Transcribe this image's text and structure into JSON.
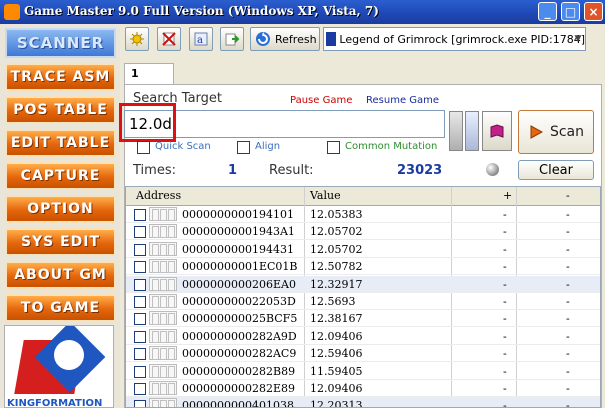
{
  "window": {
    "title": "Game Master 9.0 Full Version (Windows XP, Vista, 7)",
    "minimize": "_",
    "maximize": "□",
    "close": "×"
  },
  "sidebar": {
    "scanner": "SCANNER",
    "items": [
      {
        "label": "TRACE ASM"
      },
      {
        "label": "POS TABLE"
      },
      {
        "label": "EDIT TABLE"
      },
      {
        "label": "CAPTURE"
      },
      {
        "label": "OPTION"
      },
      {
        "label": "SYS EDIT"
      },
      {
        "label": "ABOUT GM"
      },
      {
        "label": "TO GAME"
      }
    ],
    "logo_text": "KINGFORMATION"
  },
  "toolbar": {
    "refresh_label": "Refresh",
    "process": "Legend of Grimrock [grimrock.exe PID:1784]"
  },
  "tabs": [
    {
      "label": "1"
    }
  ],
  "search": {
    "label": "Search Target",
    "pause": "Pause Game",
    "resume": "Resume Game",
    "value": "12.0d",
    "scan_label": "Scan",
    "quick_scan": "Quick Scan",
    "align": "Align",
    "common_mutation": "Common Mutation"
  },
  "stats": {
    "times_label": "Times:",
    "times_value": "1",
    "result_label": "Result:",
    "result_value": "23023",
    "clear_label": "Clear"
  },
  "table": {
    "columns": [
      "Address",
      "Value",
      "+",
      "-"
    ],
    "rows": [
      {
        "address": "0000000000194101",
        "value": "12.05383",
        "plus": "-",
        "minus": "-"
      },
      {
        "address": "00000000001943A1",
        "value": "12.05702",
        "plus": "-",
        "minus": "-"
      },
      {
        "address": "0000000000194431",
        "value": "12.05702",
        "plus": "-",
        "minus": "-"
      },
      {
        "address": "00000000001EC01B",
        "value": "12.50782",
        "plus": "-",
        "minus": "-"
      },
      {
        "address": "0000000000206EA0",
        "value": "12.32917",
        "plus": "-",
        "minus": "-"
      },
      {
        "address": "000000000022053D",
        "value": "12.5693",
        "plus": "-",
        "minus": "-"
      },
      {
        "address": "000000000025BCF5",
        "value": "12.38167",
        "plus": "-",
        "minus": "-"
      },
      {
        "address": "0000000000282A9D",
        "value": "12.09406",
        "plus": "-",
        "minus": "-"
      },
      {
        "address": "0000000000282AC9",
        "value": "12.59406",
        "plus": "-",
        "minus": "-"
      },
      {
        "address": "0000000000282B89",
        "value": "11.59405",
        "plus": "-",
        "minus": "-"
      },
      {
        "address": "0000000000282E89",
        "value": "12.09406",
        "plus": "-",
        "minus": "-"
      },
      {
        "address": "0000000000401038",
        "value": "12.20313",
        "plus": "-",
        "minus": "-"
      }
    ]
  },
  "colors": {
    "title_bar": "#1f47b3",
    "scanner_button": "#3f79d6",
    "sidebar_button": "#e5660c",
    "highlight_box": "#dd1111",
    "count_text": "#1a3ba0"
  },
  "icons": [
    "app-icon",
    "toolbar-icon-1",
    "toolbar-icon-2",
    "toolbar-icon-3",
    "toolbar-icon-4",
    "refresh-icon",
    "process-icon",
    "dropdown-arrow-icon",
    "scan-icon"
  ]
}
